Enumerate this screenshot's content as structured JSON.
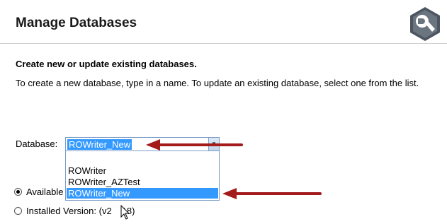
{
  "header": {
    "title": "Manage Databases",
    "icon": "wrench-settings-icon"
  },
  "section": {
    "heading": "Create new or update existing databases.",
    "description": "To create a new database, type in a name. To update an existing database, select one from the list."
  },
  "database": {
    "label": "Database:",
    "value": "ROWriter_New",
    "options": [
      "ROWriter",
      "ROWriter_AZTest",
      "ROWriter_New"
    ],
    "selected_option": "ROWriter_New"
  },
  "radios": {
    "available_label": "Available",
    "installed_label": "Installed Version: (v2",
    "installed_label_tail": "18)"
  },
  "colors": {
    "selection": "#3399ff",
    "annotation_arrow": "#a31b1b"
  }
}
